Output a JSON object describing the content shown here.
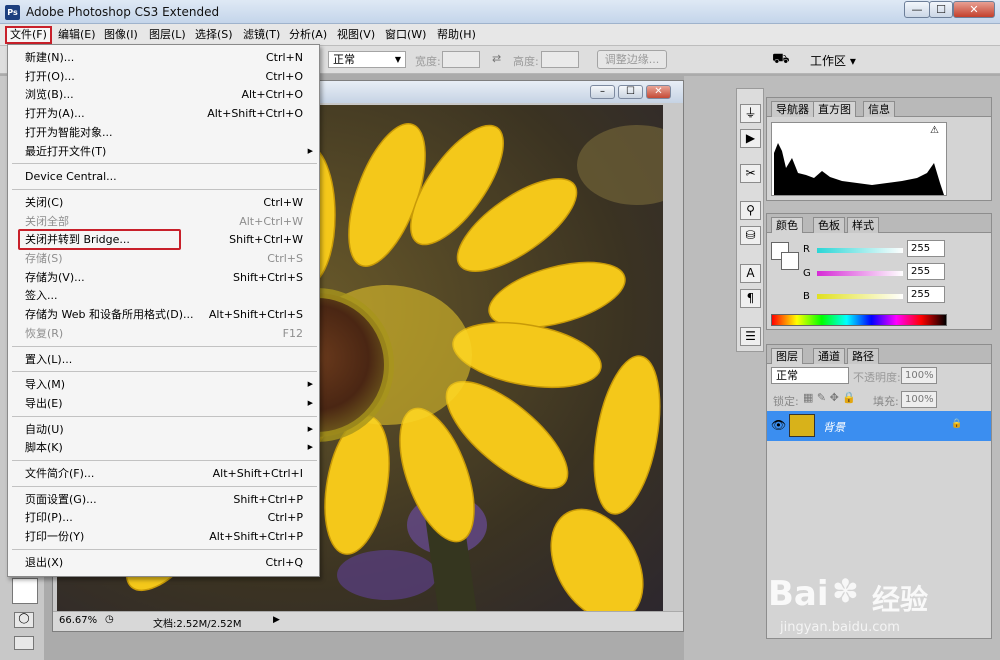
{
  "app": {
    "title": "Adobe Photoshop CS3 Extended",
    "icon_label": "Ps"
  },
  "window_controls": {
    "minimize": "—",
    "maximize": "☐",
    "close": "✕"
  },
  "menubar": [
    {
      "id": "file",
      "label": "文件(F)"
    },
    {
      "id": "edit",
      "label": "编辑(E)"
    },
    {
      "id": "image",
      "label": "图像(I)"
    },
    {
      "id": "layer",
      "label": "图层(L)"
    },
    {
      "id": "select",
      "label": "选择(S)"
    },
    {
      "id": "filter",
      "label": "滤镜(T)"
    },
    {
      "id": "analysis",
      "label": "分析(A)"
    },
    {
      "id": "view",
      "label": "视图(V)"
    },
    {
      "id": "window",
      "label": "窗口(W)"
    },
    {
      "id": "help",
      "label": "帮助(H)"
    }
  ],
  "options": {
    "style_value": "正常",
    "width_label": "宽度:",
    "height_label": "高度:",
    "refine_edge": "调整边缘...",
    "workspace": "工作区 ▾"
  },
  "file_menu": {
    "items": [
      {
        "label": "新建(N)...",
        "shortcut": "Ctrl+N"
      },
      {
        "label": "打开(O)...",
        "shortcut": "Ctrl+O"
      },
      {
        "label": "浏览(B)...",
        "shortcut": "Alt+Ctrl+O"
      },
      {
        "label": "打开为(A)...",
        "shortcut": "Alt+Shift+Ctrl+O"
      },
      {
        "label": "打开为智能对象...",
        "shortcut": ""
      },
      {
        "label": "最近打开文件(T)",
        "shortcut": "",
        "submenu": true
      },
      {
        "sep": true
      },
      {
        "label": "Device Central...",
        "shortcut": ""
      },
      {
        "sep": true
      },
      {
        "label": "关闭(C)",
        "shortcut": "Ctrl+W"
      },
      {
        "label": "关闭全部",
        "shortcut": "Alt+Ctrl+W",
        "disabled": true
      },
      {
        "label": "关闭并转到 Bridge...",
        "shortcut": "Shift+Ctrl+W",
        "highlight": true
      },
      {
        "label": "存储(S)",
        "shortcut": "Ctrl+S",
        "disabled": true
      },
      {
        "label": "存储为(V)...",
        "shortcut": "Shift+Ctrl+S"
      },
      {
        "label": "签入...",
        "shortcut": ""
      },
      {
        "label": "存储为 Web 和设备所用格式(D)...",
        "shortcut": "Alt+Shift+Ctrl+S"
      },
      {
        "label": "恢复(R)",
        "shortcut": "F12",
        "disabled": true
      },
      {
        "sep": true
      },
      {
        "label": "置入(L)...",
        "shortcut": ""
      },
      {
        "sep": true
      },
      {
        "label": "导入(M)",
        "shortcut": "",
        "submenu": true
      },
      {
        "label": "导出(E)",
        "shortcut": "",
        "submenu": true
      },
      {
        "sep": true
      },
      {
        "label": "自动(U)",
        "shortcut": "",
        "submenu": true
      },
      {
        "label": "脚本(K)",
        "shortcut": "",
        "submenu": true
      },
      {
        "sep": true
      },
      {
        "label": "文件简介(F)...",
        "shortcut": "Alt+Shift+Ctrl+I"
      },
      {
        "sep": true
      },
      {
        "label": "页面设置(G)...",
        "shortcut": "Shift+Ctrl+P"
      },
      {
        "label": "打印(P)...",
        "shortcut": "Ctrl+P"
      },
      {
        "label": "打印一份(Y)",
        "shortcut": "Alt+Shift+Ctrl+P"
      },
      {
        "sep": true
      },
      {
        "label": "退出(X)",
        "shortcut": "Ctrl+Q"
      }
    ]
  },
  "document": {
    "zoom": "66.67%",
    "doc_info": "文档:2.52M/2.52M"
  },
  "panels": {
    "histogram": {
      "tabs": [
        "导航器",
        "直方图",
        "信息"
      ]
    },
    "color": {
      "tabs": [
        "颜色",
        "色板",
        "样式"
      ],
      "channels": [
        {
          "name": "R",
          "value": "255"
        },
        {
          "name": "G",
          "value": "255"
        },
        {
          "name": "B",
          "value": "255"
        }
      ]
    },
    "layers": {
      "tabs": [
        "图层",
        "通道",
        "路径"
      ],
      "blend_mode": "正常",
      "opacity_label": "不透明度:",
      "opacity_value": "100%",
      "lock_label": "锁定:",
      "fill_label": "填充:",
      "fill_value": "100%",
      "layer_name": "背景"
    }
  },
  "watermark": {
    "brand": "Bai",
    "brand_cn": "经验",
    "url": "jingyan.baidu.com"
  },
  "colors": {
    "accent_red": "#c8202a",
    "layer_selected": "#3b8ef0"
  }
}
